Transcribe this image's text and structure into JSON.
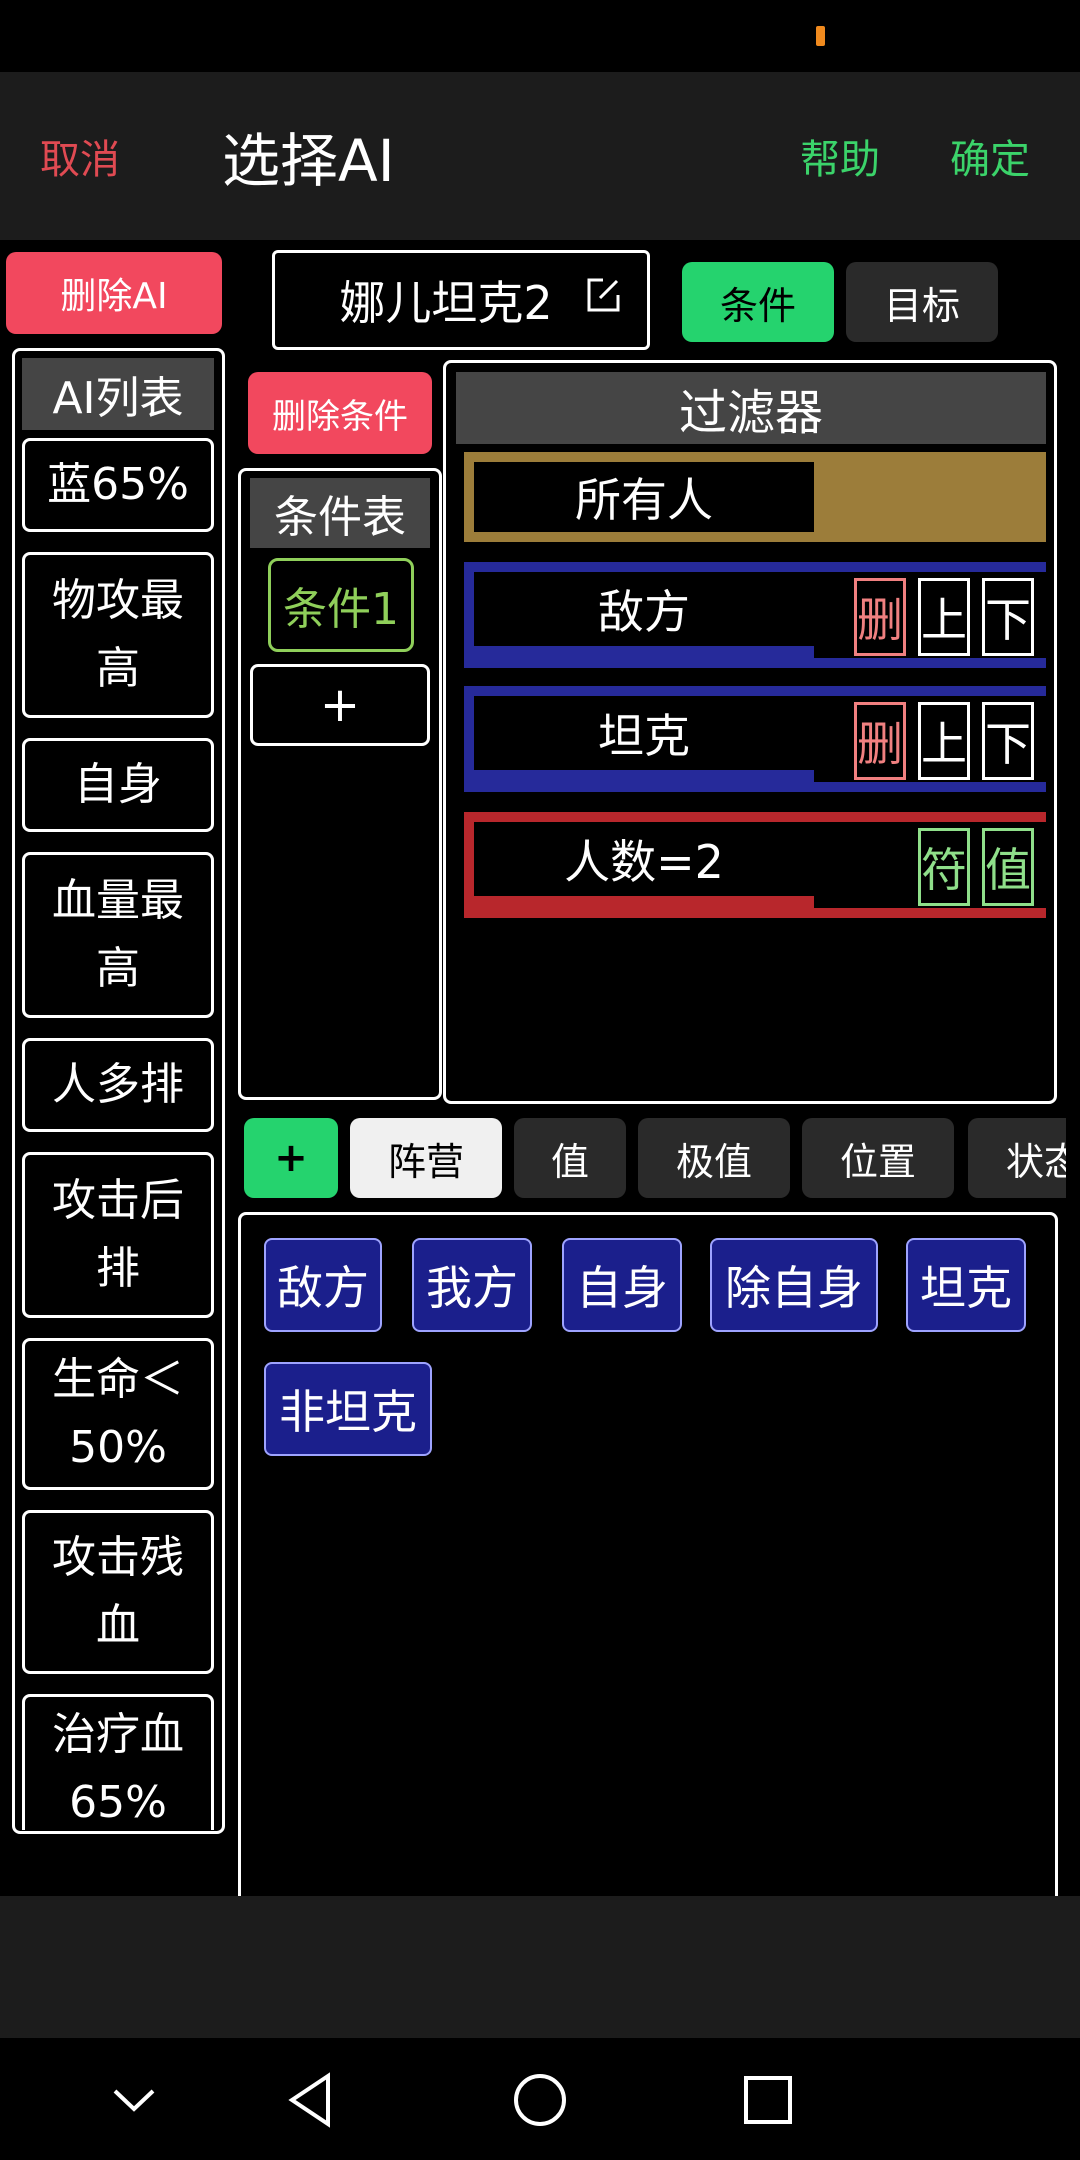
{
  "header": {
    "cancel_label": "取消",
    "title": "选择AI",
    "help_label": "帮助",
    "confirm_label": "确定"
  },
  "toolbar": {
    "delete_ai_label": "删除AI",
    "ai_name": "娜儿坦克2",
    "tab_condition": "条件",
    "tab_target": "目标"
  },
  "ai_list": {
    "header": "AI列表",
    "items": [
      "蓝65%",
      "物攻最高",
      "自身",
      "血量最高",
      "人多排",
      "攻击后排",
      "生命＜50%",
      "攻击残血",
      "治疗血65%"
    ]
  },
  "conditions": {
    "delete_label": "删除条件",
    "header": "条件表",
    "items": [
      "条件1"
    ],
    "add_label": "+"
  },
  "filter": {
    "header": "过滤器",
    "rows": [
      {
        "label": "所有人",
        "color": "#9c7d3a",
        "buttons": []
      },
      {
        "label": "敌方",
        "color": "#262a9a",
        "buttons": [
          "删",
          "上",
          "下"
        ]
      },
      {
        "label": "坦克",
        "color": "#262a9a",
        "buttons": [
          "删",
          "上",
          "下"
        ]
      },
      {
        "label": "人数=2",
        "color": "#b8272c",
        "buttons": [
          "符",
          "值"
        ]
      }
    ]
  },
  "categories": {
    "add_label": "+",
    "tabs": [
      "阵营",
      "值",
      "极值",
      "位置",
      "状态"
    ],
    "selected": "阵营"
  },
  "options": [
    "敌方",
    "我方",
    "自身",
    "除自身",
    "坦克",
    "非坦克"
  ],
  "colors": {
    "accent_green": "#25d36e",
    "danger_red": "#f2485e",
    "chip_blue": "#1b1f8c"
  }
}
